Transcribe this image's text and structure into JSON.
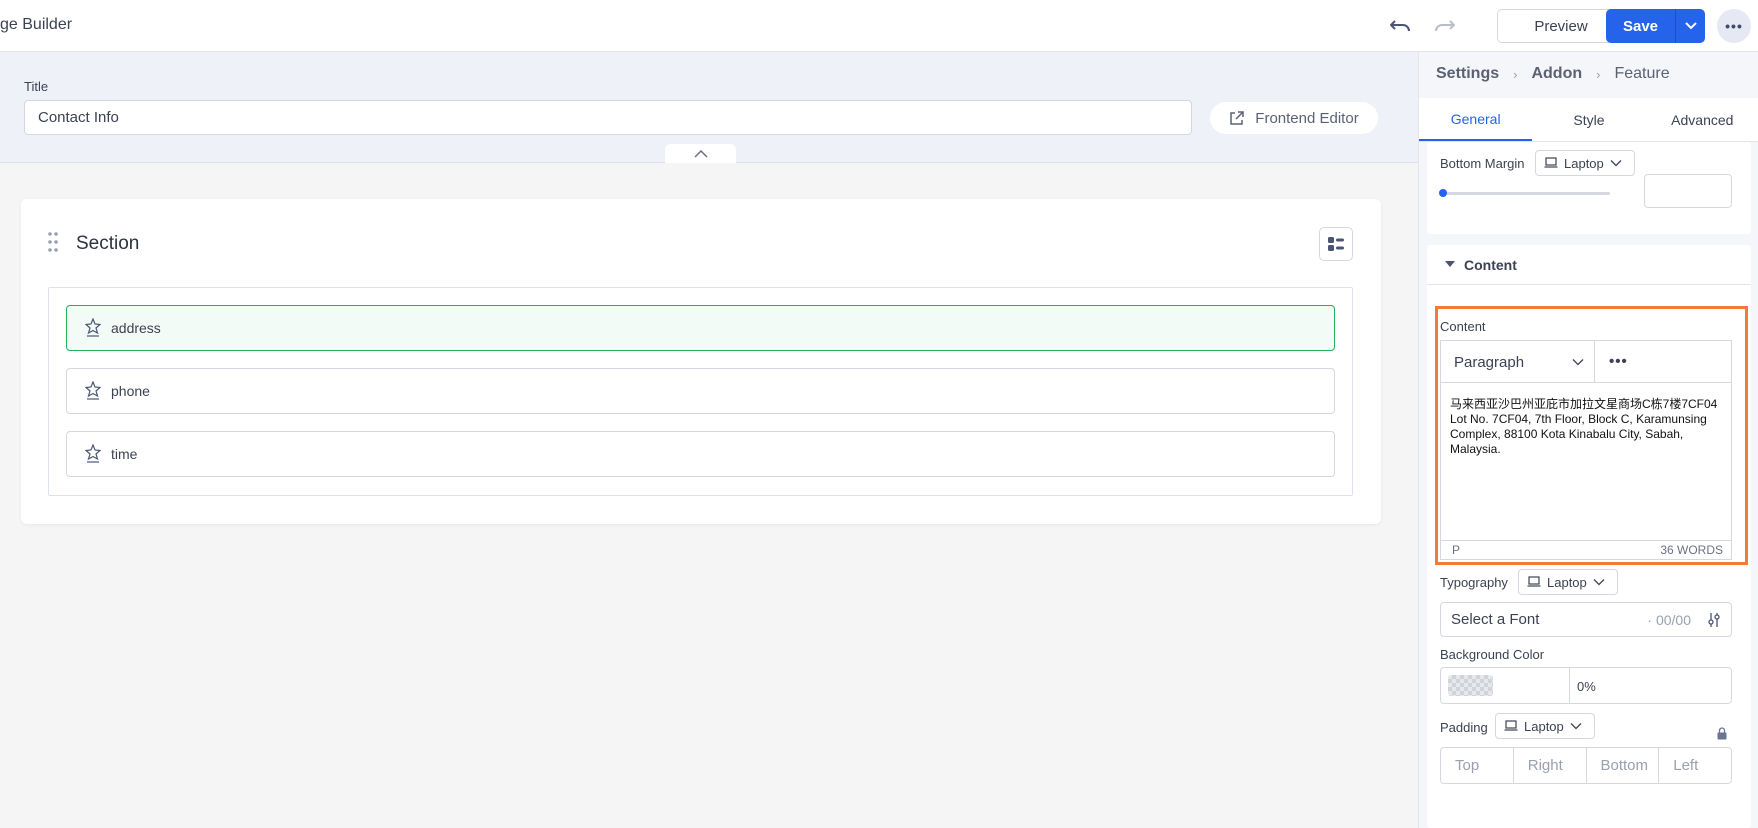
{
  "header": {
    "app_title": "ge Builder",
    "preview_label": "Preview",
    "save_label": "Save",
    "more_label": "•••"
  },
  "page": {
    "title_label": "Title",
    "title_value": "Contact Info",
    "frontend_editor_label": "Frontend Editor"
  },
  "section": {
    "title": "Section",
    "addons": [
      {
        "label": "address",
        "active": true
      },
      {
        "label": "phone",
        "active": false
      },
      {
        "label": "time",
        "active": false
      }
    ]
  },
  "panel": {
    "breadcrumb": [
      "Settings",
      "Addon",
      "Feature"
    ],
    "tabs": [
      "General",
      "Style",
      "Advanced"
    ],
    "active_tab": "General",
    "bottom_margin_label": "Bottom Margin",
    "device": "Laptop",
    "content_section_label": "Content",
    "content_label": "Content",
    "format_select": "Paragraph",
    "editor_more": "•••",
    "editor_text": "马来西亚沙巴州亚庇市加拉文星商场C栋7楼7CF04 Lot No. 7CF04, 7th Floor, Block C, Karamunsing Complex, 88100 Kota Kinabalu City, Sabah, Malaysia.",
    "editor_tag": "P",
    "word_count": "36 WORDS",
    "typography_label": "Typography",
    "font_placeholder": "Select a Font",
    "font_count": "00/00",
    "bg_color_label": "Background Color",
    "bg_opacity": "0%",
    "padding_label": "Padding",
    "padding_fields": [
      "Top",
      "Right",
      "Bottom",
      "Left"
    ]
  },
  "colors": {
    "accent": "#2563eb",
    "active_addon_border": "#22b15a",
    "highlight": "#f47a38"
  }
}
